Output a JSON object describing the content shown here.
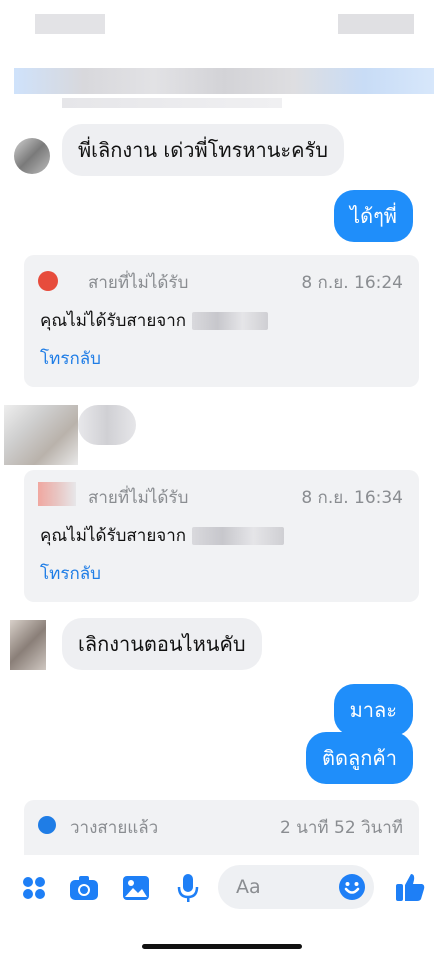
{
  "messages": {
    "msg1": "พี่เลิกงาน เด่วพี่โทรหานะครับ",
    "msg2": "ได้ๆพี่",
    "msg3": "เลิกงานตอนไหนคับ",
    "msg4": "มาละ",
    "msg5": "ติดลูกค้า"
  },
  "calls": [
    {
      "title": "สายที่ไม่ได้รับ",
      "time": "8 ก.ย. 16:24",
      "body": "คุณไม่ได้รับสายจาก",
      "cta": "โทรกลับ"
    },
    {
      "title": "สายที่ไม่ได้รับ",
      "time": "8 ก.ย. 16:34",
      "body": "คุณไม่ได้รับสายจาก",
      "cta": "โทรกลับ"
    },
    {
      "title": "วางสายแล้ว",
      "time": "2 นาที 52 วินาที"
    }
  ],
  "composer": {
    "placeholder": "Aa"
  },
  "icons": [
    "grid-icon",
    "camera-icon",
    "gallery-icon",
    "mic-icon",
    "emoji-icon",
    "like-icon"
  ],
  "colors": {
    "accent": "#1f8efa",
    "link": "#1f7de6"
  }
}
